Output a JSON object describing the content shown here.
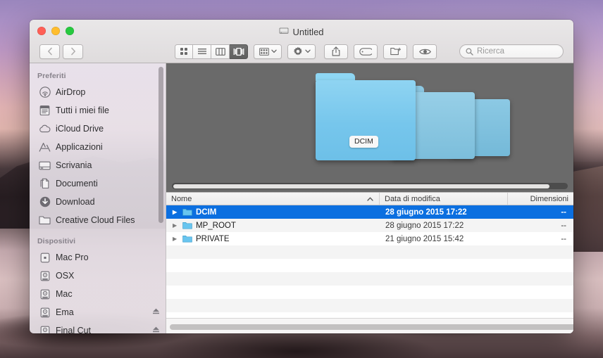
{
  "window": {
    "title": "Untitled",
    "title_icon": "disk-drive-icon",
    "traffic_lights": [
      "close-button",
      "minimize-button",
      "zoom-button"
    ]
  },
  "toolbar": {
    "back_label": "‹",
    "forward_label": "›",
    "view_modes": [
      {
        "name": "icon-view",
        "icon": "grid-icon",
        "active": false
      },
      {
        "name": "list-view",
        "icon": "list-icon",
        "active": false
      },
      {
        "name": "column-view",
        "icon": "columns-icon",
        "active": false
      },
      {
        "name": "coverflow-view",
        "icon": "coverflow-icon",
        "active": true
      }
    ],
    "arrange_icon": "arrange-grid-icon",
    "action_icon": "gear-icon",
    "share_icon": "share-icon",
    "tag_icon": "tag-icon",
    "new_folder_icon": "new-folder-icon",
    "quicklook_icon": "eye-icon"
  },
  "search": {
    "placeholder": "Ricerca",
    "value": "",
    "icon": "search-icon"
  },
  "sidebar": {
    "sections": [
      {
        "header": "Preferiti",
        "items": [
          {
            "label": "AirDrop",
            "icon": "airdrop-icon",
            "eject": false
          },
          {
            "label": "Tutti i miei file",
            "icon": "all-files-icon",
            "eject": false
          },
          {
            "label": "iCloud Drive",
            "icon": "icloud-icon",
            "eject": false
          },
          {
            "label": "Applicazioni",
            "icon": "applications-icon",
            "eject": false
          },
          {
            "label": "Scrivania",
            "icon": "desktop-icon",
            "eject": false
          },
          {
            "label": "Documenti",
            "icon": "documents-icon",
            "eject": false
          },
          {
            "label": "Download",
            "icon": "downloads-icon",
            "eject": false
          },
          {
            "label": "Creative Cloud Files",
            "icon": "folder-icon",
            "eject": false
          }
        ]
      },
      {
        "header": "Dispositivi",
        "items": [
          {
            "label": "Mac Pro",
            "icon": "mac-pro-icon",
            "eject": false
          },
          {
            "label": "OSX",
            "icon": "hard-disk-icon",
            "eject": false
          },
          {
            "label": "Mac",
            "icon": "hard-disk-icon",
            "eject": false
          },
          {
            "label": "Ema",
            "icon": "hard-disk-icon",
            "eject": true
          },
          {
            "label": "Final Cut",
            "icon": "hard-disk-icon",
            "eject": true
          }
        ]
      }
    ]
  },
  "coverflow": {
    "selected_label": "DCIM",
    "items": [
      {
        "label": "DCIM",
        "icon": "folder-icon"
      },
      {
        "label": "MP_ROOT",
        "icon": "folder-icon"
      },
      {
        "label": "PRIVATE",
        "icon": "folder-icon"
      }
    ]
  },
  "filelist": {
    "columns": [
      {
        "label": "Nome",
        "sort": "asc",
        "sort_glyph": "⌃"
      },
      {
        "label": "Data di modifica",
        "sort": null
      },
      {
        "label": "Dimensioni",
        "sort": null
      }
    ],
    "rows": [
      {
        "name": "DCIM",
        "date": "28 giugno 2015 17:22",
        "size": "--",
        "selected": true,
        "expandable": true
      },
      {
        "name": "MP_ROOT",
        "date": "28 giugno 2015 17:22",
        "size": "--",
        "selected": false,
        "expandable": true
      },
      {
        "name": "PRIVATE",
        "date": "21 giugno 2015 15:42",
        "size": "--",
        "selected": false,
        "expandable": true
      }
    ]
  },
  "colors": {
    "selection_blue": "#0b6fe0",
    "coverflow_bg": "#6a6a6a",
    "folder_blue": "#6dc6f0",
    "alt_row": "#f4f4f4"
  }
}
